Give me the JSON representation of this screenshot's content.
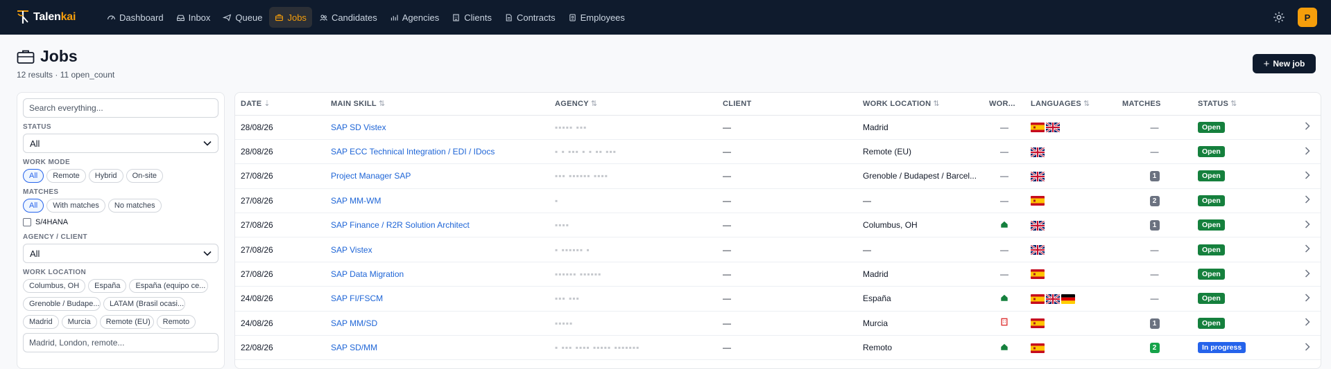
{
  "brand": {
    "name_main": "Talen",
    "name_accent": "kai"
  },
  "nav": [
    {
      "label": "Dashboard",
      "icon": "dashboard-icon",
      "active": false
    },
    {
      "label": "Inbox",
      "icon": "inbox-icon",
      "active": false
    },
    {
      "label": "Queue",
      "icon": "queue-icon",
      "active": false
    },
    {
      "label": "Jobs",
      "icon": "briefcase-icon",
      "active": true
    },
    {
      "label": "Candidates",
      "icon": "users-icon",
      "active": false
    },
    {
      "label": "Agencies",
      "icon": "chart-icon",
      "active": false
    },
    {
      "label": "Clients",
      "icon": "building-icon",
      "active": false
    },
    {
      "label": "Contracts",
      "icon": "document-icon",
      "active": false
    },
    {
      "label": "Employees",
      "icon": "badge-icon",
      "active": false
    }
  ],
  "user": {
    "initial": "P"
  },
  "page": {
    "title": "Jobs",
    "subtitle": "12 results · 11 open_count",
    "new_job_label": "New job"
  },
  "filters": {
    "search_placeholder": "Search everything...",
    "status_label": "STATUS",
    "status_value": "All",
    "work_mode_label": "WORK MODE",
    "work_mode_options": [
      "All",
      "Remote",
      "Hybrid",
      "On-site"
    ],
    "matches_label": "MATCHES",
    "matches_options": [
      "All",
      "With matches",
      "No matches"
    ],
    "s4hana_label": "S/4HANA",
    "agency_client_label": "AGENCY / CLIENT",
    "agency_client_value": "All",
    "work_location_label": "WORK LOCATION",
    "work_location_chips": [
      "Columbus, OH",
      "España",
      "España (equipo ce...",
      "Grenoble / Budape...",
      "LATAM (Brasil ocasi...",
      "Madrid",
      "Murcia",
      "Remote (EU)",
      "Remoto"
    ],
    "work_location_placeholder": "Madrid, London, remote..."
  },
  "table": {
    "headers": {
      "date": "DATE",
      "main_skill": "MAIN SKILL",
      "agency": "AGENCY",
      "client": "CLIENT",
      "work_location": "WORK LOCATION",
      "work_mode": "WOR...",
      "languages": "LANGUAGES",
      "matches": "MATCHES",
      "status": "STATUS"
    },
    "rows": [
      {
        "date": "28/08/26",
        "skill": "SAP SD Vistex",
        "agency": "▪▪▪▪▪ ▪▪▪",
        "client": "—",
        "location": "Madrid",
        "mode": "—",
        "mode_icon": "",
        "langs": [
          "es",
          "gb"
        ],
        "matches": "—",
        "status": "Open"
      },
      {
        "date": "28/08/26",
        "skill": "SAP ECC Technical Integration / EDI / IDocs",
        "agency": "▪ ▪ ▪▪▪ ▪ ▪ ▪▪ ▪▪▪",
        "client": "—",
        "location": "Remote (EU)",
        "mode": "—",
        "mode_icon": "",
        "langs": [
          "gb"
        ],
        "matches": "—",
        "status": "Open"
      },
      {
        "date": "27/08/26",
        "skill": "Project Manager SAP",
        "agency": "▪▪▪ ▪▪▪▪▪▪ ▪▪▪▪",
        "client": "—",
        "location": "Grenoble / Budapest / Barcel...",
        "mode": "—",
        "mode_icon": "",
        "langs": [
          "gb"
        ],
        "matches": "1",
        "status": "Open"
      },
      {
        "date": "27/08/26",
        "skill": "SAP MM-WM",
        "agency": "▪",
        "client": "—",
        "location": "—",
        "mode": "—",
        "mode_icon": "",
        "langs": [
          "es"
        ],
        "matches": "2",
        "status": "Open"
      },
      {
        "date": "27/08/26",
        "skill": "SAP Finance / R2R Solution Architect",
        "agency": "▪▪▪▪",
        "client": "—",
        "location": "Columbus, OH",
        "mode": "",
        "mode_icon": "home",
        "langs": [
          "gb"
        ],
        "matches": "1",
        "status": "Open"
      },
      {
        "date": "27/08/26",
        "skill": "SAP Vistex",
        "agency": "▪ ▪▪▪▪▪▪ ▪",
        "client": "—",
        "location": "—",
        "mode": "—",
        "mode_icon": "",
        "langs": [
          "gb"
        ],
        "matches": "—",
        "status": "Open"
      },
      {
        "date": "27/08/26",
        "skill": "SAP Data Migration",
        "agency": "▪▪▪▪▪▪ ▪▪▪▪▪▪",
        "client": "—",
        "location": "Madrid",
        "mode": "—",
        "mode_icon": "",
        "langs": [
          "es"
        ],
        "matches": "—",
        "status": "Open"
      },
      {
        "date": "24/08/26",
        "skill": "SAP FI/FSCM",
        "agency": "▪▪▪ ▪▪▪",
        "client": "—",
        "location": "España",
        "mode": "",
        "mode_icon": "home",
        "langs": [
          "es",
          "gb",
          "de"
        ],
        "matches": "—",
        "status": "Open"
      },
      {
        "date": "24/08/26",
        "skill": "SAP MM/SD",
        "agency": "▪▪▪▪▪",
        "client": "—",
        "location": "Murcia",
        "mode": "",
        "mode_icon": "office",
        "langs": [
          "es"
        ],
        "matches": "1",
        "status": "Open"
      },
      {
        "date": "22/08/26",
        "skill": "SAP SD/MM",
        "agency": "▪ ▪▪▪ ▪▪▪▪ ▪▪▪▪▪ ▪▪▪▪▪▪▪",
        "client": "—",
        "location": "Remoto",
        "mode": "",
        "mode_icon": "home",
        "langs": [
          "es"
        ],
        "matches": "2",
        "status": "In progress"
      }
    ]
  },
  "colors": {
    "nav_bg": "#0f1b2d",
    "accent": "#f59e0b",
    "link": "#1d64d6",
    "open": "#15803d",
    "in_progress": "#2563eb",
    "match_green": "#16a34a"
  }
}
